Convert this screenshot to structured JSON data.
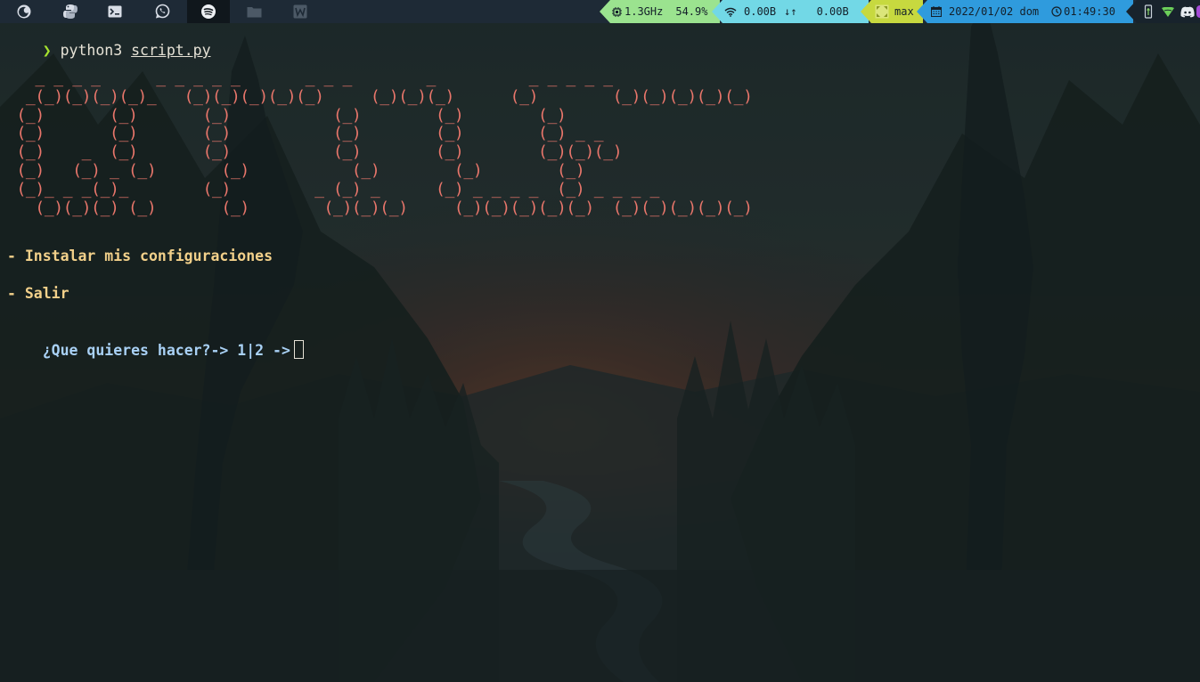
{
  "topbar": {
    "workspaces": [
      {
        "icon": "firefox-icon",
        "active": false
      },
      {
        "icon": "python-icon",
        "active": false
      },
      {
        "icon": "terminal-icon",
        "active": false
      },
      {
        "icon": "whatsapp-icon",
        "active": false
      },
      {
        "icon": "spotify-icon",
        "active": true
      },
      {
        "icon": "folder-icon",
        "active": false
      },
      {
        "icon": "word-icon",
        "active": false
      }
    ],
    "cpu_freq": "1.3GHz",
    "cpu_usage": "54.9%",
    "net_down": "0.00B",
    "net_arrows": "↓↑",
    "net_up": "0.00B",
    "layout": "max",
    "date": "2022/01/02 dom",
    "time": "01:49:30",
    "colors": {
      "cpu_segment": "#9be38f",
      "net_segment": "#72d8e6",
      "layout_segment": "#c7d93f",
      "date_segment": "#2f9bdd",
      "bar_background": "#1e2a36"
    }
  },
  "terminal": {
    "prompt_symbol": "❯",
    "command": "python3",
    "argument": "script.py",
    "banner_lines": [
      "   _ _ _ _      _ _ _ _ _       _ _ _        _          _ _ _ _ _",
      "  _(_)(_)(_)(_)_   (_)(_)(_)(_)(_)     (_)(_)(_)      (_)        (_)(_)(_)(_)(_)",
      " (_)       (_)       (_)           (_)        (_)        (_)",
      " (_)       (_)       (_)           (_)        (_)        (_) _ _",
      " (_)    _  (_)       (_)           (_)        (_)        (_)(_)(_)",
      " (_)   (_) _ (_)       (_)           (_)        (_)        (_)",
      " (_)_ _ _(_)_        (_)         _ (_) _      (_) _ _ _ _  (_) _ _ _ _",
      "   (_)(_)(_) (_)       (_)        (_)(_)(_)     (_)(_)(_)(_)(_)  (_)(_)(_)(_)(_)"
    ],
    "banner_color": "#e9766b",
    "menu_items": [
      "- Instalar mis configuraciones",
      "- Salir"
    ],
    "menu_color": "#f2d08a",
    "question": "¿Que quieres hacer?-> 1|2 ->",
    "question_color": "#a9d1f5"
  }
}
